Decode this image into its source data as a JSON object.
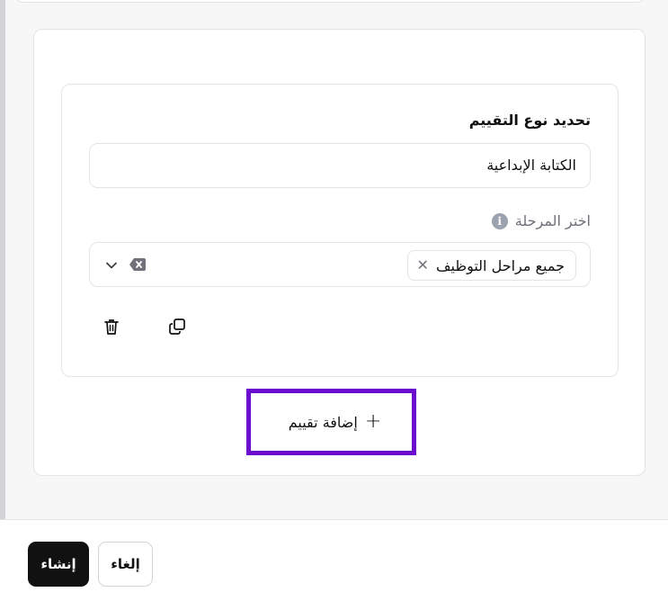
{
  "assessment": {
    "type_label": "تحديد نوع التقييم",
    "type_value": "الكتابة الإبداعية",
    "stage_label": "اختر المرحلة",
    "stage_info_icon": "info-icon",
    "stage_chip": "جميع مراحل التوظيف",
    "chip_remove_glyph": "✕",
    "actions": {
      "copy_icon": "copy-icon",
      "delete_icon": "trash-icon"
    }
  },
  "add_assessment": {
    "plus": "+",
    "label": "إضافة تقييم"
  },
  "footer": {
    "create_label": "إنشاء",
    "cancel_label": "إلغاء"
  },
  "colors": {
    "highlight": "#6a0dcf",
    "primary_button": "#111111",
    "muted_text": "#71717a"
  }
}
